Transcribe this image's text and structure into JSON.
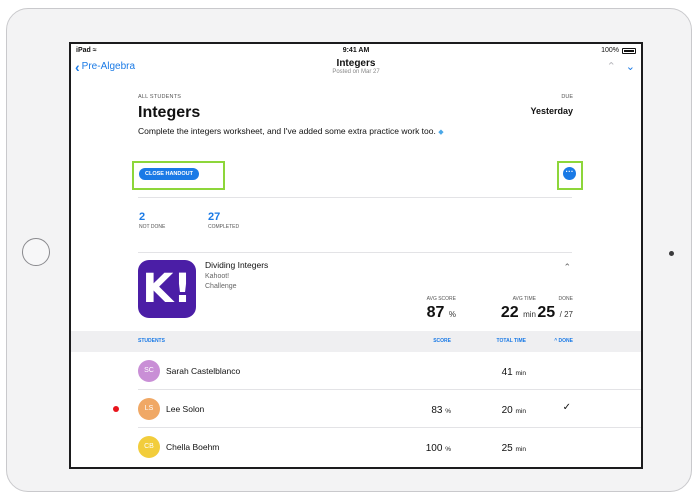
{
  "status_bar": {
    "device": "iPad",
    "time": "9:41 AM",
    "battery": "100%"
  },
  "nav": {
    "back_label": "Pre-Algebra",
    "title": "Integers",
    "subtitle": "Posted on Mar 27"
  },
  "assignment": {
    "audience": "ALL STUDENTS",
    "title": "Integers",
    "description": "Complete the integers worksheet, and I've added some extra practice work too.",
    "due_label": "DUE",
    "due_value": "Yesterday",
    "close_button": "CLOSE HANDOUT"
  },
  "stats": [
    {
      "value": "2",
      "label": "NOT DONE"
    },
    {
      "value": "27",
      "label": "COMPLETED"
    }
  ],
  "activity": {
    "icon_text": "K!",
    "name": "Dividing Integers",
    "provider": "Kahoot!",
    "type": "Challenge",
    "metrics": {
      "avg_score_label": "AVG SCORE",
      "avg_score": "87",
      "avg_score_unit": "%",
      "avg_time_label": "AVG TIME",
      "avg_time": "22",
      "avg_time_unit": "min",
      "done_label": "DONE",
      "done": "25",
      "done_total": "/ 27"
    }
  },
  "table": {
    "headers": {
      "students": "STUDENTS",
      "score": "SCORE",
      "total_time": "TOTAL TIME",
      "done": "^ DONE"
    },
    "rows": [
      {
        "initials": "SC",
        "name": "Sarah Castelblanco",
        "score": "",
        "score_unit": "",
        "time": "41",
        "time_unit": "min",
        "done": "",
        "color": "#c98fd6",
        "flag": false
      },
      {
        "initials": "LS",
        "name": "Lee Solon",
        "score": "83",
        "score_unit": "%",
        "time": "20",
        "time_unit": "min",
        "done": "✓",
        "color": "#f0a865",
        "flag": true
      },
      {
        "initials": "CB",
        "name": "Chella Boehm",
        "score": "100",
        "score_unit": "%",
        "time": "25",
        "time_unit": "min",
        "done": "",
        "color": "#f2cd3c",
        "flag": false
      }
    ]
  },
  "colors": {
    "accent": "#1a7ae6",
    "highlight": "#8dd63a",
    "alert": "#e8141c"
  }
}
